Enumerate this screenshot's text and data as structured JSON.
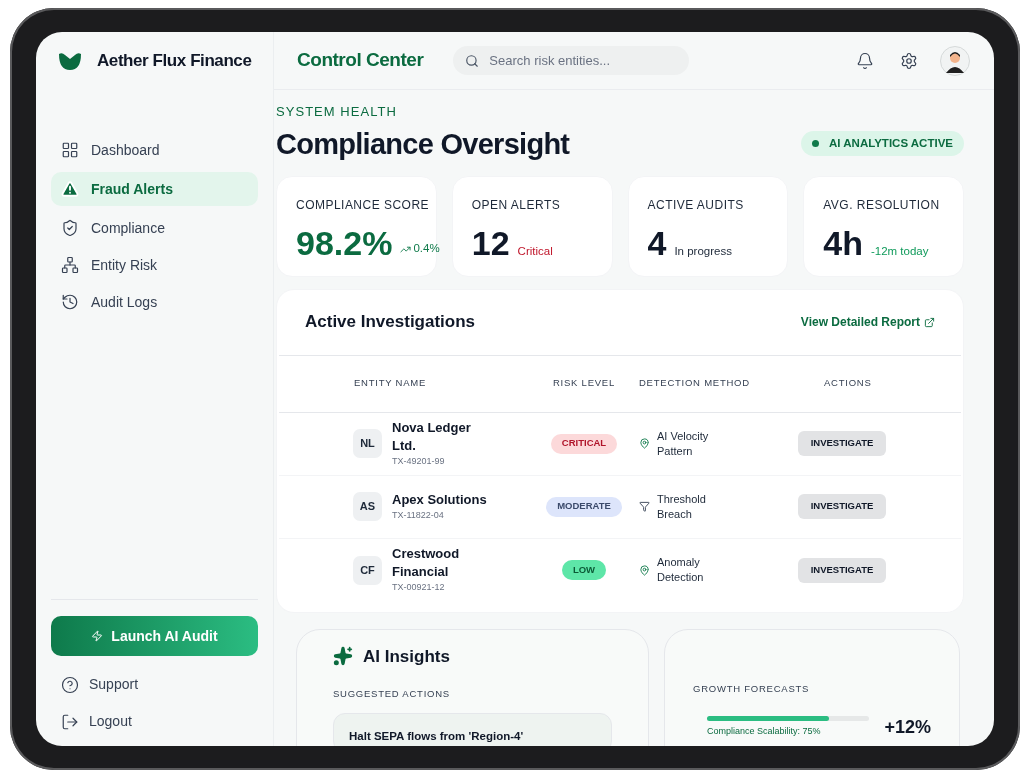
{
  "brand": {
    "name": "Aether Flux Finance"
  },
  "header": {
    "title": "Control Center",
    "search": {
      "placeholder": "Search risk entities..."
    }
  },
  "nav": [
    {
      "label": "Dashboard",
      "selected": false
    },
    {
      "label": "Fraud Alerts",
      "selected": true
    },
    {
      "label": "Compliance",
      "selected": false
    },
    {
      "label": "Entity Risk",
      "selected": false
    },
    {
      "label": "Audit Logs",
      "selected": false
    }
  ],
  "launch_button": "Launch AI Audit",
  "footer_nav": [
    "Support",
    "Logout"
  ],
  "eyebrow": "SYSTEM HEALTH",
  "heading": "Compliance Oversight",
  "status_badge": {
    "label": "AI ANALYTICS ACTIVE",
    "color": "#0f7a4a"
  },
  "stats": [
    {
      "label": "COMPLIANCE SCORE",
      "value": "98.2%",
      "note": "0.4%",
      "kind": "trend"
    },
    {
      "label": "OPEN ALERTS",
      "value": "12",
      "note": "Critical",
      "kind": "critical"
    },
    {
      "label": "ACTIVE AUDITS",
      "value": "4",
      "note": "In progress",
      "kind": "neutral"
    },
    {
      "label": "AVG. RESOLUTION",
      "value": "4h",
      "note": "-12m today",
      "kind": "positive"
    }
  ],
  "investigations": {
    "title": "Active Investigations",
    "link": "View Detailed Report",
    "columns": [
      "ENTITY NAME",
      "RISK LEVEL",
      "DETECTION METHOD",
      "ACTIONS"
    ],
    "rows": [
      {
        "initials": "NL",
        "name": "Nova Ledger Ltd.",
        "id": "TX-49201-99",
        "risk": "CRITICAL",
        "kind": "critical",
        "method": "AI Velocity Pattern",
        "action": "INVESTIGATE"
      },
      {
        "initials": "AS",
        "name": "Apex Solutions",
        "id": "TX-11822-04",
        "risk": "MODERATE",
        "kind": "moderate",
        "method": "Threshold Breach",
        "action": "INVESTIGATE"
      },
      {
        "initials": "CF",
        "name": "Crestwood Financial",
        "id": "TX-00921-12",
        "risk": "LOW",
        "kind": "low",
        "method": "Anomaly Detection",
        "action": "INVESTIGATE"
      }
    ]
  },
  "insights": {
    "title": "AI Insights",
    "subtitle": "SUGGESTED ACTIONS",
    "actions": [
      "Halt SEPA flows from 'Region-4'"
    ]
  },
  "forecasts": {
    "title": "GROWTH FORECASTS",
    "items": [
      {
        "label": "Compliance Scalability: 75%",
        "level": 0.75,
        "value": "+12%"
      }
    ]
  }
}
